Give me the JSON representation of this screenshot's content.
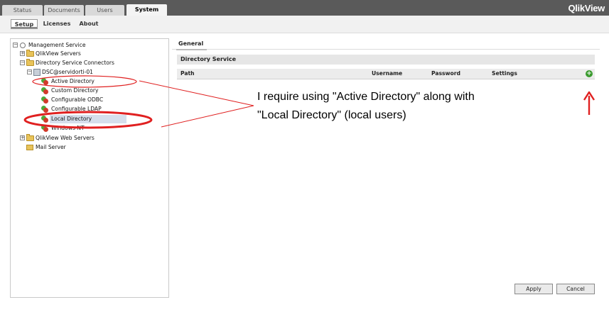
{
  "top_tabs": [
    {
      "label": "Status",
      "active": false
    },
    {
      "label": "Documents",
      "active": false
    },
    {
      "label": "Users",
      "active": false
    },
    {
      "label": "System",
      "active": true
    }
  ],
  "brand": "QlikView",
  "sub_tabs": [
    {
      "label": "Setup",
      "active": true
    },
    {
      "label": "Licenses",
      "active": false
    },
    {
      "label": "About",
      "active": false
    }
  ],
  "tree": {
    "root": "Management Service",
    "qlikview_servers": "QlikView Servers",
    "dsc_folder": "Directory Service Connectors",
    "dsc_node": "DSC@servidorti-01",
    "connectors": [
      "Active Directory",
      "Custom Directory",
      "Configurable ODBC",
      "Configurable LDAP",
      "Local Directory",
      "Windows NT"
    ],
    "web_servers": "QlikView Web Servers",
    "mail_server": "Mail Server",
    "selected": "Local Directory"
  },
  "content": {
    "tab": "General",
    "section": "Directory Service",
    "columns": [
      "Path",
      "Username",
      "Password",
      "Settings"
    ]
  },
  "buttons": {
    "apply": "Apply",
    "cancel": "Cancel"
  },
  "annotation": {
    "line1": "I require using \"Active Directory\" along with",
    "line2": "\"Local Directory\" (local users)",
    "color": "#e02020"
  }
}
